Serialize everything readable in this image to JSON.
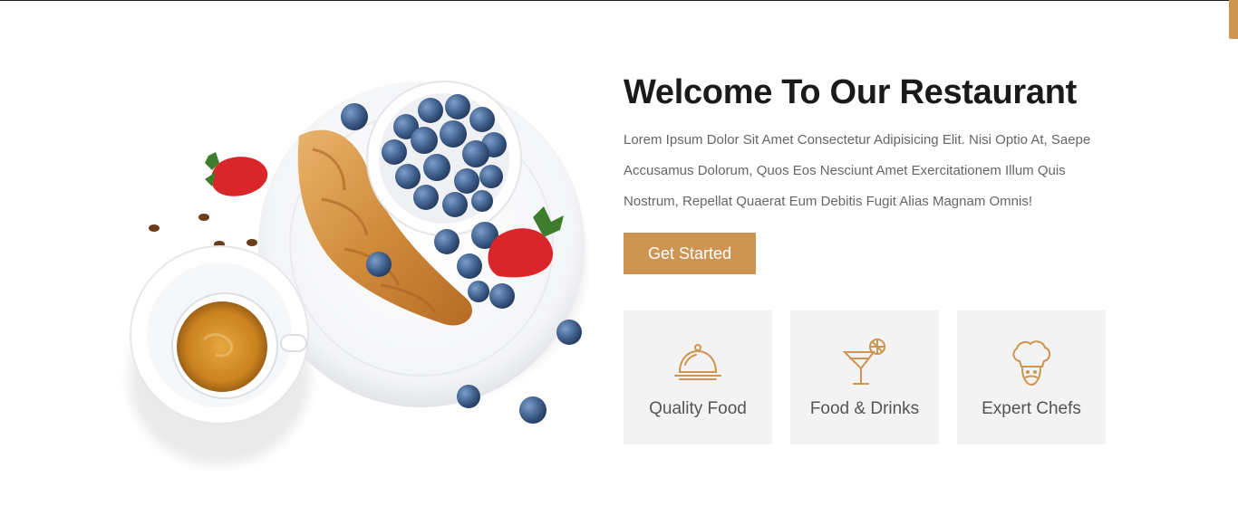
{
  "colors": {
    "accent": "#cd9452",
    "title": "#1a1a1a",
    "text": "#666666",
    "card_bg": "#f3f3f3"
  },
  "hero": {
    "image": "breakfast-plate-coffee-croissant-blueberries"
  },
  "welcome": {
    "title": "Welcome To Our Restaurant",
    "description": "Lorem Ipsum Dolor Sit Amet Consectetur Adipisicing Elit. Nisi Optio At, Saepe Accusamus Dolorum, Quos Eos Nesciunt Amet Exercitationem Illum Quis Nostrum, Repellat Quaerat Eum Debitis Fugit Alias Magnam Omnis!",
    "cta_label": "Get Started"
  },
  "features": [
    {
      "label": "Quality Food",
      "icon": "serving-cloche-icon"
    },
    {
      "label": "Food & Drinks",
      "icon": "cocktail-glass-icon"
    },
    {
      "label": "Expert Chefs",
      "icon": "chef-hat-icon"
    }
  ]
}
